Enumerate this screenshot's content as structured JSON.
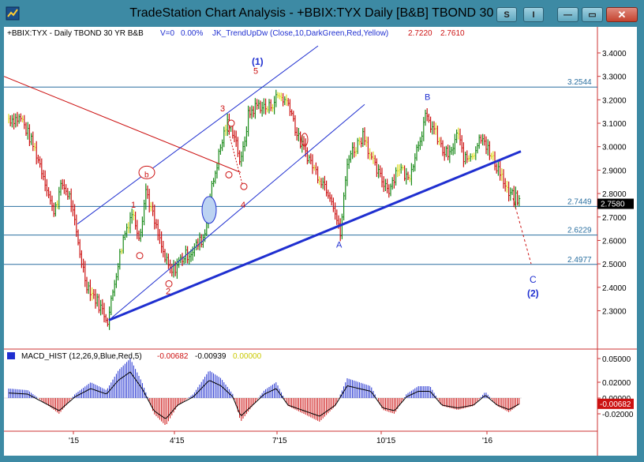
{
  "window": {
    "title": "TradeStation Chart Analysis - +BBIX:TYX Daily [B&B] TBOND 30 YR",
    "s_button": "S",
    "i_button": "I",
    "minimize_glyph": "—",
    "maximize_glyph": "▭",
    "close_glyph": "✕"
  },
  "header": {
    "symbol": "+BBIX:TYX - Daily  TBOND 30 YR  B&B",
    "volume": "V=0",
    "change": "0.00%",
    "indicator": "JK_TrendUpDw (Close,10,DarkGreen,Red,Yellow)",
    "value1": "2.7220",
    "value2": "2.7610"
  },
  "macd": {
    "label": "MACD_HIST (12,26,9,Blue,Red,5)",
    "value1": "-0.00682",
    "value2": "-0.00939",
    "value3": "0.00000",
    "current": "-0.00682",
    "ticks": [
      "0.05000",
      "0.02000",
      "0.00000",
      "-0.02000"
    ]
  },
  "price_axis": {
    "ticks": [
      "3.4000",
      "3.3000",
      "3.2000",
      "3.1000",
      "3.0000",
      "2.9000",
      "2.8000",
      "2.7000",
      "2.6000",
      "2.5000",
      "2.4000",
      "2.3000"
    ],
    "last_price": "2.7580"
  },
  "fib_levels": [
    "3.2544",
    "2.7449",
    "2.6229",
    "2.4977"
  ],
  "date_axis": [
    "'15",
    "4'15",
    "7'15",
    "10'15",
    "'16"
  ],
  "wave_labels": {
    "wave_1_top": "(1)",
    "five": "5",
    "three": "3",
    "four": "4",
    "one": "1",
    "two": "2",
    "b_small": "b",
    "a_small": "a",
    "c_small": "c",
    "A": "A",
    "B": "B",
    "C": "C",
    "wave_2": "(2)"
  },
  "colors": {
    "bar_green": "#1a8a1a",
    "bar_red": "#cc1111",
    "bar_yellow": "#dddd22",
    "trend_blue": "#1f2fd0",
    "channel_red": "#cc1111",
    "fib_line": "#2a6fa0",
    "fib_text": "#2a6fa0",
    "grid_red": "#cc3333"
  }
}
